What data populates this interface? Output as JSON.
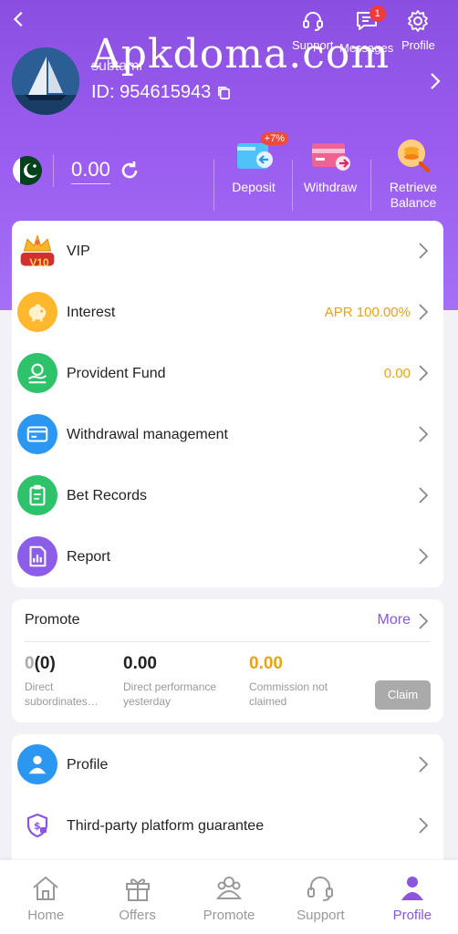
{
  "header": {
    "watermark": "Apkdoma.com",
    "support_label": "Support",
    "messages_label": "Messages",
    "messages_badge": "1",
    "profile_label": "Profile"
  },
  "user": {
    "name": "subtami",
    "id": "ID: 954615943"
  },
  "wallet": {
    "balance": "0.00",
    "deposit_label": "Deposit",
    "deposit_badge": "+7%",
    "withdraw_label": "Withdraw",
    "retrieve_label_1": "Retrieve",
    "retrieve_label_2": "Balance"
  },
  "menu": {
    "items": [
      {
        "label": "VIP",
        "value": "",
        "badge": "V10"
      },
      {
        "label": "Interest",
        "value": "APR 100.00%"
      },
      {
        "label": "Provident Fund",
        "value": "0.00"
      },
      {
        "label": "Withdrawal management",
        "value": ""
      },
      {
        "label": "Bet Records",
        "value": ""
      },
      {
        "label": "Report",
        "value": ""
      }
    ]
  },
  "promote": {
    "title": "Promote",
    "more": "More",
    "stat1_main": "0",
    "stat1_sub": "(0)",
    "stat1_cap1": "Direct",
    "stat1_cap2": "subordinates…",
    "stat2_value": "0.00",
    "stat2_cap1": "Direct performance",
    "stat2_cap2": "yesterday",
    "stat3_value": "0.00",
    "stat3_cap1": "Commission not",
    "stat3_cap2": "claimed",
    "claim": "Claim"
  },
  "bottom_menu": {
    "items": [
      {
        "label": "Profile"
      },
      {
        "label": "Third-party platform guarantee"
      }
    ]
  },
  "tabs": [
    {
      "label": "Home"
    },
    {
      "label": "Offers"
    },
    {
      "label": "Promote"
    },
    {
      "label": "Support"
    },
    {
      "label": "Profile"
    }
  ],
  "colors": {
    "primary": "#8b55e0",
    "accent_value": "#e8a317",
    "claim_disabled": "#aaaaaa"
  }
}
